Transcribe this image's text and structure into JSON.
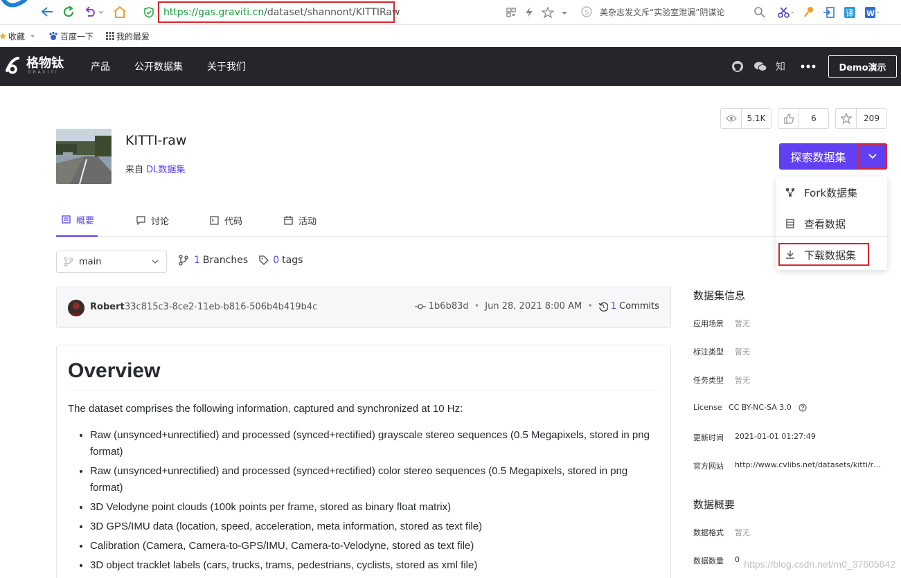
{
  "browser": {
    "url_scheme_host": "https://gas.graviti.cn",
    "url_path": "/dataset/shannont/KITTIRaw",
    "news": "美杂志发文斥“实验室泄漏”阴谋论",
    "bookmarks": [
      "收藏",
      "百度一下",
      "我的最爱"
    ]
  },
  "header": {
    "logo_text": "格物钛",
    "logo_sub": "GRAVITI",
    "nav": [
      "产品",
      "公开数据集",
      "关于我们"
    ],
    "zhihu": "知",
    "demo_button": "Demo演示"
  },
  "stats": {
    "views": "5.1K",
    "likes": "6",
    "stars": "209"
  },
  "dataset": {
    "title": "KITTI-raw",
    "from_label": "来自",
    "from_link": "DL数据集",
    "explore_button": "探索数据集"
  },
  "dropdown": {
    "items": [
      "Fork数据集",
      "查看数据",
      "下载数据集"
    ]
  },
  "tabs": [
    "概要",
    "讨论",
    "代码",
    "活动"
  ],
  "branch": {
    "selected": "main",
    "branches_count": "1",
    "branches_label": "Branches",
    "tags_count": "0",
    "tags_label": "tags"
  },
  "commit": {
    "author": "Robert",
    "hash": "33c815c3-8ce2-11eb-b816-506b4b419b4c",
    "short_hash": "1b6b83d",
    "date": "Jun 28, 2021 8:00 AM",
    "commits_count": "1",
    "commits_label": "Commits"
  },
  "readme": {
    "heading": "Overview",
    "intro": "The dataset comprises the following information, captured and synchronized at 10 Hz:",
    "items": [
      "Raw (unsynced+unrectified) and processed (synced+rectified) grayscale stereo sequences (0.5 Megapixels, stored in png format)",
      "Raw (unsynced+unrectified) and processed (synced+rectified) color stereo sequences (0.5 Megapixels, stored in png format)",
      "3D Velodyne point clouds (100k points per frame, stored as binary float matrix)",
      "3D GPS/IMU data (location, speed, acceleration, meta information, stored as text file)",
      "Calibration (Camera, Camera-to-GPS/IMU, Camera-to-Velodyne, stored as text file)",
      "3D object tracklet labels (cars, trucks, trams, pedestrians, cyclists, stored as xml file)"
    ]
  },
  "sidebar": {
    "info_title": "数据集信息",
    "info": [
      {
        "label": "应用场景",
        "value": "暂无"
      },
      {
        "label": "标注类型",
        "value": "暂无"
      },
      {
        "label": "任务类型",
        "value": "暂无"
      },
      {
        "label": "License",
        "value": "CC BY-NC-SA 3.0"
      },
      {
        "label": "更新时间",
        "value": "2021-01-01 01:27:49"
      },
      {
        "label": "官方网站",
        "value": "http://www.cvlibs.net/datasets/kitti/ra..."
      }
    ],
    "overview_title": "数据概要",
    "overview": [
      {
        "label": "数据格式",
        "value": "暂无"
      },
      {
        "label": "数据数量",
        "value": "0"
      }
    ]
  },
  "watermark": "https://blog.csdn.net/m0_37605642",
  "colors": {
    "accent": "#6240f1",
    "header_bg": "#25252c",
    "highlight_red": "#d9262c"
  }
}
